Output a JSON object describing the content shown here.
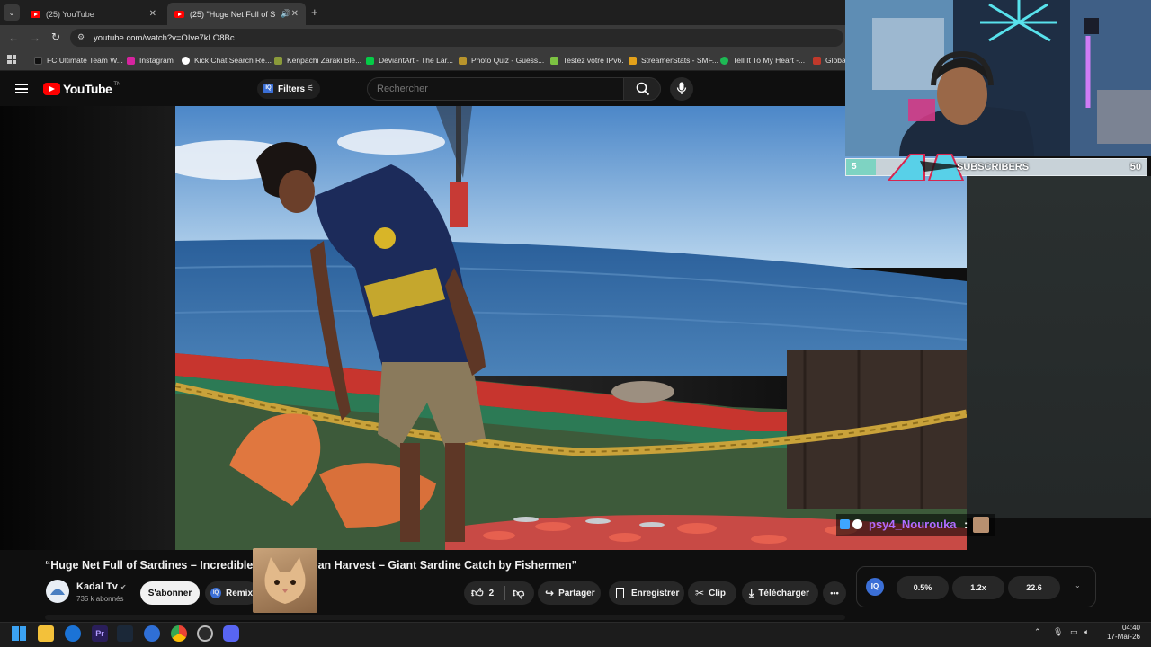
{
  "browser": {
    "tabs": [
      {
        "title": "(25) YouTube"
      },
      {
        "title": "(25) \"Huge Net Full of Sardi"
      }
    ],
    "new_tab": "+",
    "url": "youtube.com/watch?v=OIve7kLO8Bc",
    "bookmarks": [
      {
        "label": "FC Ultimate Team W...",
        "color": "#111111"
      },
      {
        "label": "Instagram",
        "color": "#d6249f"
      },
      {
        "label": "Kick Chat Search Re...",
        "color": "#ffffff"
      },
      {
        "label": "Kenpachi Zaraki Ble...",
        "color": "#8a9a3a"
      },
      {
        "label": "DeviantArt - The Lar...",
        "color": "#05cc47"
      },
      {
        "label": "Photo Quiz - Guess...",
        "color": "#b8942c"
      },
      {
        "label": "Testez votre IPv6.",
        "color": "#7cc242"
      },
      {
        "label": "StreamerStats - SMF...",
        "color": "#e3a11a"
      },
      {
        "label": "Tell It To My Heart -...",
        "color": "#1db954"
      },
      {
        "label": "Globa",
        "color": "#c0392b"
      }
    ]
  },
  "youtube": {
    "logo": "YouTube",
    "logo_region": "TN",
    "filters_label": "Filters",
    "search_placeholder": "Rechercher",
    "video_title": "“Huge Net Full of Sardines – Incredible Catch | Ocean Harvest – Giant Sardine Catch by Fishermen”",
    "channel": {
      "name": "Kadal Tv",
      "subscribers": "735 k abonnés"
    },
    "subscribe_label": "S'abonner",
    "remix_label": "Remix",
    "likes": "2",
    "share_label": "Partager",
    "save_label": "Enregistrer",
    "clip_label": "Clip",
    "download_label": "Télécharger",
    "more_label": "•••"
  },
  "stream_overlay": {
    "sub_goal_current": "5",
    "sub_goal_label": "SUBSCRIBERS",
    "sub_goal_target": "50",
    "sub_goal_progress": 0.1,
    "chat_user": "psy4_Nourouka",
    "chat_separator": ":"
  },
  "iq_extension": {
    "badge": "IQ",
    "values": [
      "0.5%",
      "1.2x",
      "22.6"
    ]
  },
  "taskbar": {
    "time": "04:40",
    "date": "17-Mar-26"
  },
  "colors": {
    "youtube_red": "#ff0000",
    "chat_name": "#b06cff",
    "accent_blue": "#3ea6ff"
  }
}
